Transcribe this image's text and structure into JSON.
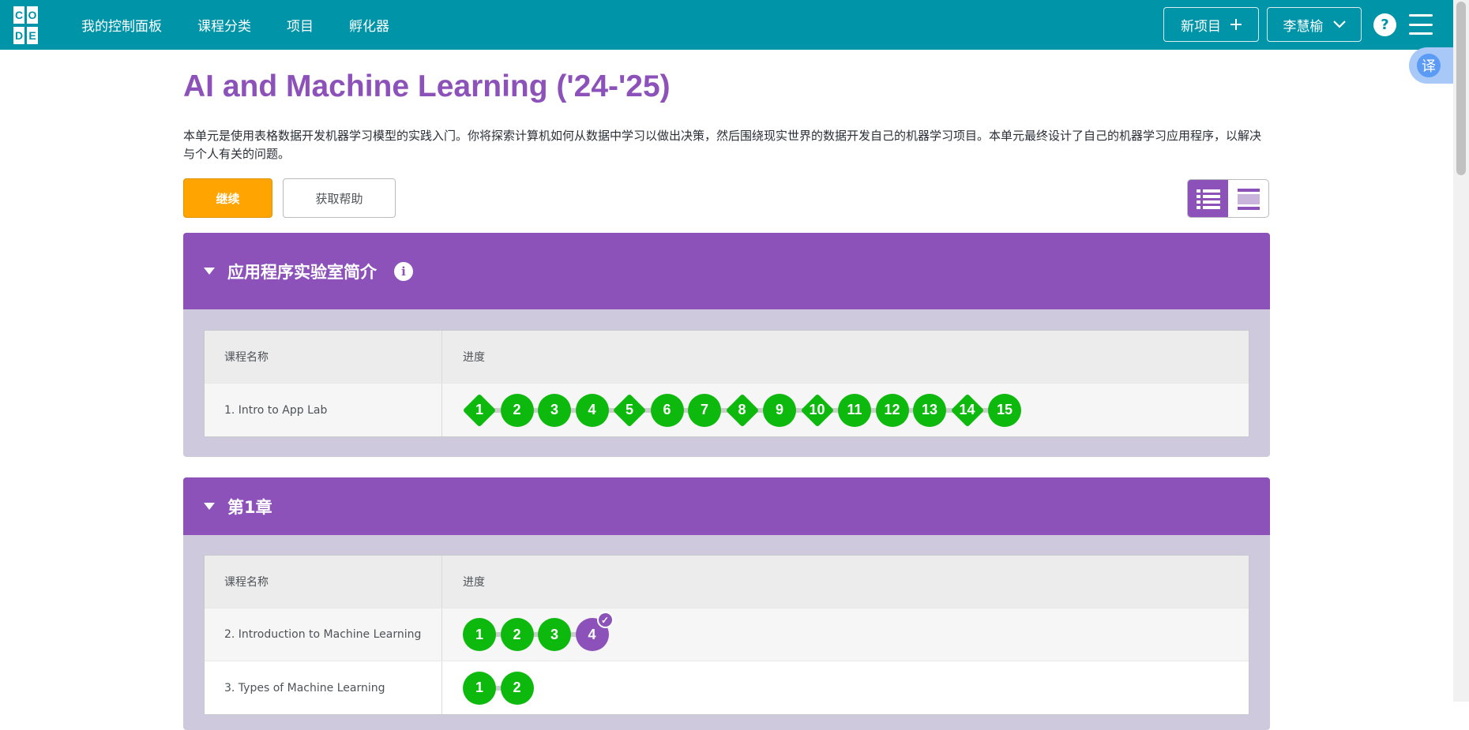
{
  "header": {
    "logo_letters": [
      "C",
      "O",
      "D",
      "E"
    ],
    "nav": [
      "我的控制面板",
      "课程分类",
      "项目",
      "孵化器"
    ],
    "new_project_label": "新项目",
    "user_name": "李慧榆",
    "help_glyph": "?",
    "bg_color": "#0094a8"
  },
  "translate": {
    "glyph": "译"
  },
  "course": {
    "title": "AI and Machine Learning ('24-'25)",
    "description": "本单元是使用表格数据开发机器学习模型的实践入门。你将探索计算机如何从数据中学习以做出决策，然后围绕现实世界的数据开发自己的机器学习项目。本单元最终设计了自己的机器学习应用程序，以解决与个人有关的问题。",
    "continue_label": "继续",
    "help_label": "获取帮助",
    "accent_color": "#8c52ba"
  },
  "sections": [
    {
      "title": "应用程序实验室简介",
      "col_name": "课程名称",
      "col_progress": "进度",
      "lessons": [
        {
          "name": "1. Intro to App Lab",
          "levels": [
            {
              "n": "1",
              "shape": "diamond"
            },
            {
              "n": "2",
              "shape": "circle"
            },
            {
              "n": "3",
              "shape": "circle"
            },
            {
              "n": "4",
              "shape": "circle"
            },
            {
              "n": "5",
              "shape": "diamond"
            },
            {
              "n": "6",
              "shape": "circle"
            },
            {
              "n": "7",
              "shape": "circle"
            },
            {
              "n": "8",
              "shape": "diamond"
            },
            {
              "n": "9",
              "shape": "circle"
            },
            {
              "n": "10",
              "shape": "diamond"
            },
            {
              "n": "11",
              "shape": "circle"
            },
            {
              "n": "12",
              "shape": "circle"
            },
            {
              "n": "13",
              "shape": "circle"
            },
            {
              "n": "14",
              "shape": "diamond"
            },
            {
              "n": "15",
              "shape": "circle"
            }
          ]
        }
      ]
    },
    {
      "title": "第1章",
      "col_name": "课程名称",
      "col_progress": "进度",
      "lessons": [
        {
          "name": "2. Introduction to Machine Learning",
          "levels": [
            {
              "n": "1",
              "shape": "circle"
            },
            {
              "n": "2",
              "shape": "circle"
            },
            {
              "n": "3",
              "shape": "circle"
            },
            {
              "n": "4",
              "shape": "circle",
              "current": true
            }
          ]
        },
        {
          "name": "3. Types of Machine Learning",
          "levels": [
            {
              "n": "1",
              "shape": "circle"
            },
            {
              "n": "2",
              "shape": "circle"
            }
          ]
        }
      ]
    }
  ]
}
